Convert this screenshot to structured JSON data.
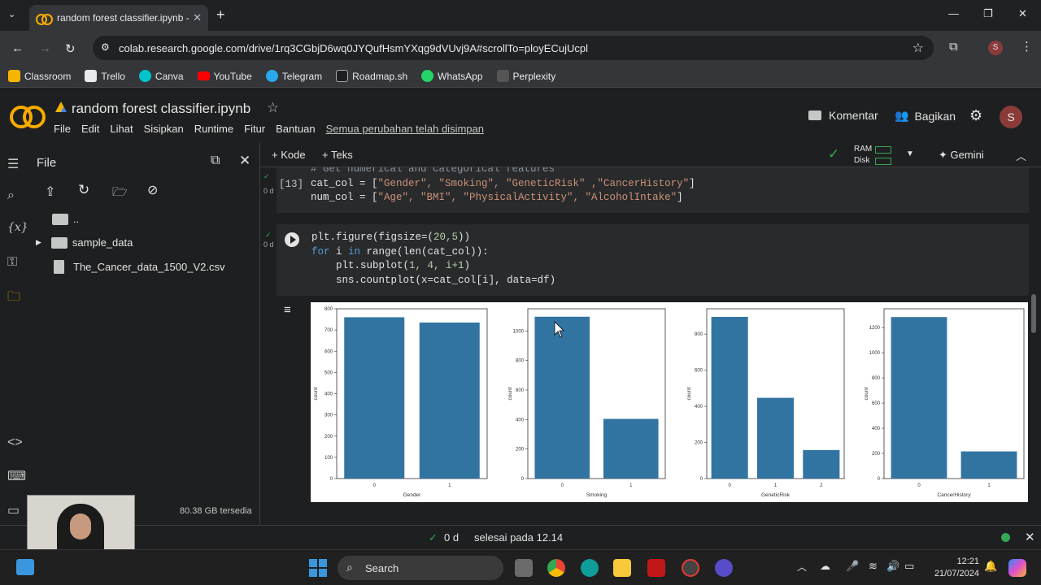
{
  "browser": {
    "tab_title": "random forest classifier.ipynb -",
    "tab_close": "✕",
    "new_tab": "+",
    "url": "colab.research.google.com/drive/1rq3CGbjD6wq0JYQufHsmYXqg9dVUvj9A#scrollTo=ployECujUcpl",
    "profile_initial": "S",
    "bookmarks": [
      "Classroom",
      "Trello",
      "Canva",
      "YouTube",
      "Telegram",
      "Roadmap.sh",
      "WhatsApp",
      "Perplexity"
    ]
  },
  "colab": {
    "notebook_name": "random forest classifier.ipynb",
    "menu": [
      "File",
      "Edit",
      "Lihat",
      "Sisipkan",
      "Runtime",
      "Fitur",
      "Bantuan"
    ],
    "saved_status": "Semua perubahan telah disimpan",
    "comment_label": "Komentar",
    "share_label": "Bagikan",
    "user_initial": "S",
    "add_code": "Kode",
    "add_text": "Teks",
    "ram_label": "RAM",
    "disk_label": "Disk",
    "gemini_label": "Gemini"
  },
  "sidebar": {
    "title": "File",
    "files": [
      {
        "name": "..",
        "type": "folder"
      },
      {
        "name": "sample_data",
        "type": "folder"
      },
      {
        "name": "The_Cancer_data_1500_V2.csv",
        "type": "file"
      }
    ],
    "disk_available": "80.38 GB tersedia"
  },
  "cells": {
    "cell1": {
      "exec_count": "[13]",
      "time": "0 d",
      "comment": "# Get numerical and categorical features",
      "line1_a": "cat_col = [",
      "line1_s": "\"Gender\", \"Smoking\", \"GeneticRisk\" ,\"CancerHistory\"",
      "line1_b": "]",
      "line2_a": "num_col = [",
      "line2_s": "\"Age\", \"BMI\", \"PhysicalActivity\", \"AlcoholIntake\"",
      "line2_b": "]"
    },
    "cell2": {
      "time": "0 d",
      "l1a": "plt.figure(figsize=(",
      "l1n": "20,5",
      "l1b": "))",
      "l2k": "for",
      "l2a": " i ",
      "l2k2": "in",
      "l2b": " range(len(cat_col)):",
      "l3a": "    plt.subplot(",
      "l3n": "1, 4, i+1",
      "l3b": ")",
      "l4a": "    sns.countplot(x=cat_col[",
      "l4n": "i",
      "l4b": "], data=df)"
    }
  },
  "chart_data": [
    {
      "type": "bar",
      "categories": [
        "0",
        "1"
      ],
      "values": [
        760,
        735
      ],
      "xlabel": "Gender",
      "ylabel": "count",
      "ylim": [
        0,
        800
      ],
      "yticks": [
        0,
        100,
        200,
        300,
        400,
        500,
        600,
        700,
        800
      ],
      "color": "#3274a1"
    },
    {
      "type": "bar",
      "categories": [
        "0",
        "1"
      ],
      "values": [
        1096,
        404
      ],
      "xlabel": "Smoking",
      "ylabel": "count",
      "ylim": [
        0,
        1150
      ],
      "yticks": [
        0,
        200,
        400,
        600,
        800,
        1000
      ],
      "color": "#3274a1"
    },
    {
      "type": "bar",
      "categories": [
        "0",
        "1",
        "2"
      ],
      "values": [
        895,
        447,
        158
      ],
      "xlabel": "GeneticRisk",
      "ylabel": "count",
      "ylim": [
        0,
        940
      ],
      "yticks": [
        0,
        200,
        400,
        600,
        800
      ],
      "color": "#3274a1"
    },
    {
      "type": "bar",
      "categories": [
        "0",
        "1"
      ],
      "values": [
        1284,
        216
      ],
      "xlabel": "CancerHistory",
      "ylabel": "count",
      "ylim": [
        0,
        1350
      ],
      "yticks": [
        0,
        200,
        400,
        600,
        800,
        1000,
        1200
      ],
      "color": "#3274a1"
    }
  ],
  "status": {
    "check": "✓",
    "time": "0 d",
    "message": "selesai pada 12.14"
  },
  "taskbar": {
    "search_label": "Search",
    "time": "12:21",
    "date": "21/07/2024"
  }
}
